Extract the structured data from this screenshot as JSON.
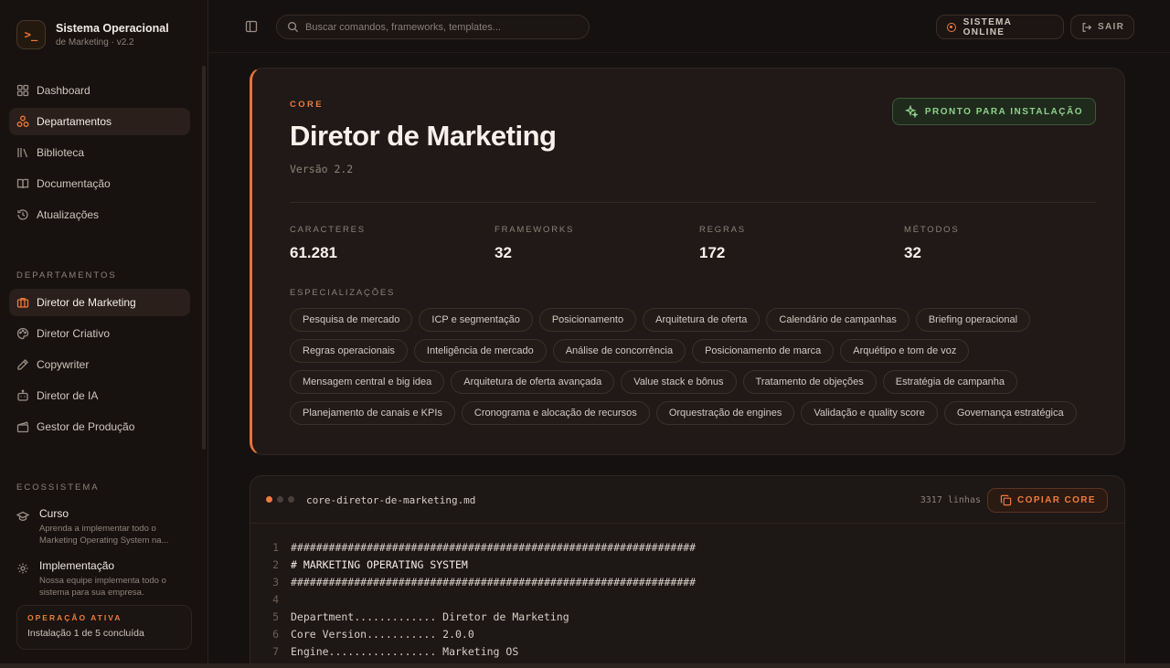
{
  "brand": {
    "title": "Sistema Operacional",
    "subtitle": "de Marketing · v2.2",
    "logo_icon": "terminal-icon"
  },
  "sidebar": {
    "main_nav": [
      {
        "label": "Dashboard",
        "icon": "grid-icon",
        "active": false
      },
      {
        "label": "Departamentos",
        "icon": "network-icon",
        "active": true
      },
      {
        "label": "Biblioteca",
        "icon": "library-icon",
        "active": false
      },
      {
        "label": "Documentação",
        "icon": "book-icon",
        "active": false
      },
      {
        "label": "Atualizações",
        "icon": "history-icon",
        "active": false
      }
    ],
    "departments_label": "DEPARTAMENTOS",
    "departments": [
      {
        "label": "Diretor de Marketing",
        "icon": "briefcase-icon",
        "active": true
      },
      {
        "label": "Diretor Criativo",
        "icon": "palette-icon",
        "active": false
      },
      {
        "label": "Copywriter",
        "icon": "pen-icon",
        "active": false
      },
      {
        "label": "Diretor de IA",
        "icon": "bot-icon",
        "active": false
      },
      {
        "label": "Gestor de Produção",
        "icon": "clapperboard-icon",
        "active": false
      }
    ],
    "ecosystem_label": "ECOSSISTEMA",
    "ecosystem": [
      {
        "title": "Curso",
        "description": "Aprenda a implementar todo o Marketing Operating System na...",
        "icon": "graduation-cap-icon"
      },
      {
        "title": "Implementação",
        "description": "Nossa equipe implementa todo o sistema para sua empresa.",
        "icon": "gear-icon"
      }
    ],
    "operation": {
      "label": "OPERAÇÃO ATIVA",
      "text": "Instalação 1 de 5 concluída"
    }
  },
  "topbar": {
    "search_placeholder": "Buscar comandos, frameworks, templates...",
    "status_label": "SISTEMA ONLINE",
    "logout_label": "SAIR"
  },
  "hero": {
    "kicker": "CORE",
    "title": "Diretor de Marketing",
    "version": "Versão 2.2",
    "ready_label": "PRONTO PARA INSTALAÇÃO",
    "stats": [
      {
        "label": "CARACTERES",
        "value": "61.281"
      },
      {
        "label": "FRAMEWORKS",
        "value": "32"
      },
      {
        "label": "REGRAS",
        "value": "172"
      },
      {
        "label": "MÉTODOS",
        "value": "32"
      }
    ],
    "specializations_label": "ESPECIALIZAÇÕES",
    "specializations": [
      "Pesquisa de mercado",
      "ICP e segmentação",
      "Posicionamento",
      "Arquitetura de oferta",
      "Calendário de campanhas",
      "Briefing operacional",
      "Regras operacionais",
      "Inteligência de mercado",
      "Análise de concorrência",
      "Posicionamento de marca",
      "Arquétipo e tom de voz",
      "Mensagem central e big idea",
      "Arquitetura de oferta avançada",
      "Value stack e bônus",
      "Tratamento de objeções",
      "Estratégia de campanha",
      "Planejamento de canais e KPIs",
      "Cronograma e alocação de recursos",
      "Orquestração de engines",
      "Validação e quality score",
      "Governança estratégica"
    ]
  },
  "code": {
    "file_name": "core-diretor-de-marketing.md",
    "line_count": "3317 linhas",
    "copy_label": "COPIAR CORE",
    "lines": [
      {
        "n": "1",
        "text": "################################################################"
      },
      {
        "n": "2",
        "text": "# MARKETING OPERATING SYSTEM"
      },
      {
        "n": "3",
        "text": "################################################################"
      },
      {
        "n": "4",
        "text": ""
      },
      {
        "n": "5",
        "text": "Department............. Diretor de Marketing"
      },
      {
        "n": "6",
        "text": "Core Version........... 2.0.0"
      },
      {
        "n": "7",
        "text": "Engine................. Marketing OS"
      }
    ]
  },
  "colors": {
    "accent": "#ef7b3c",
    "success": "#8fd08a",
    "background": "#151110"
  }
}
